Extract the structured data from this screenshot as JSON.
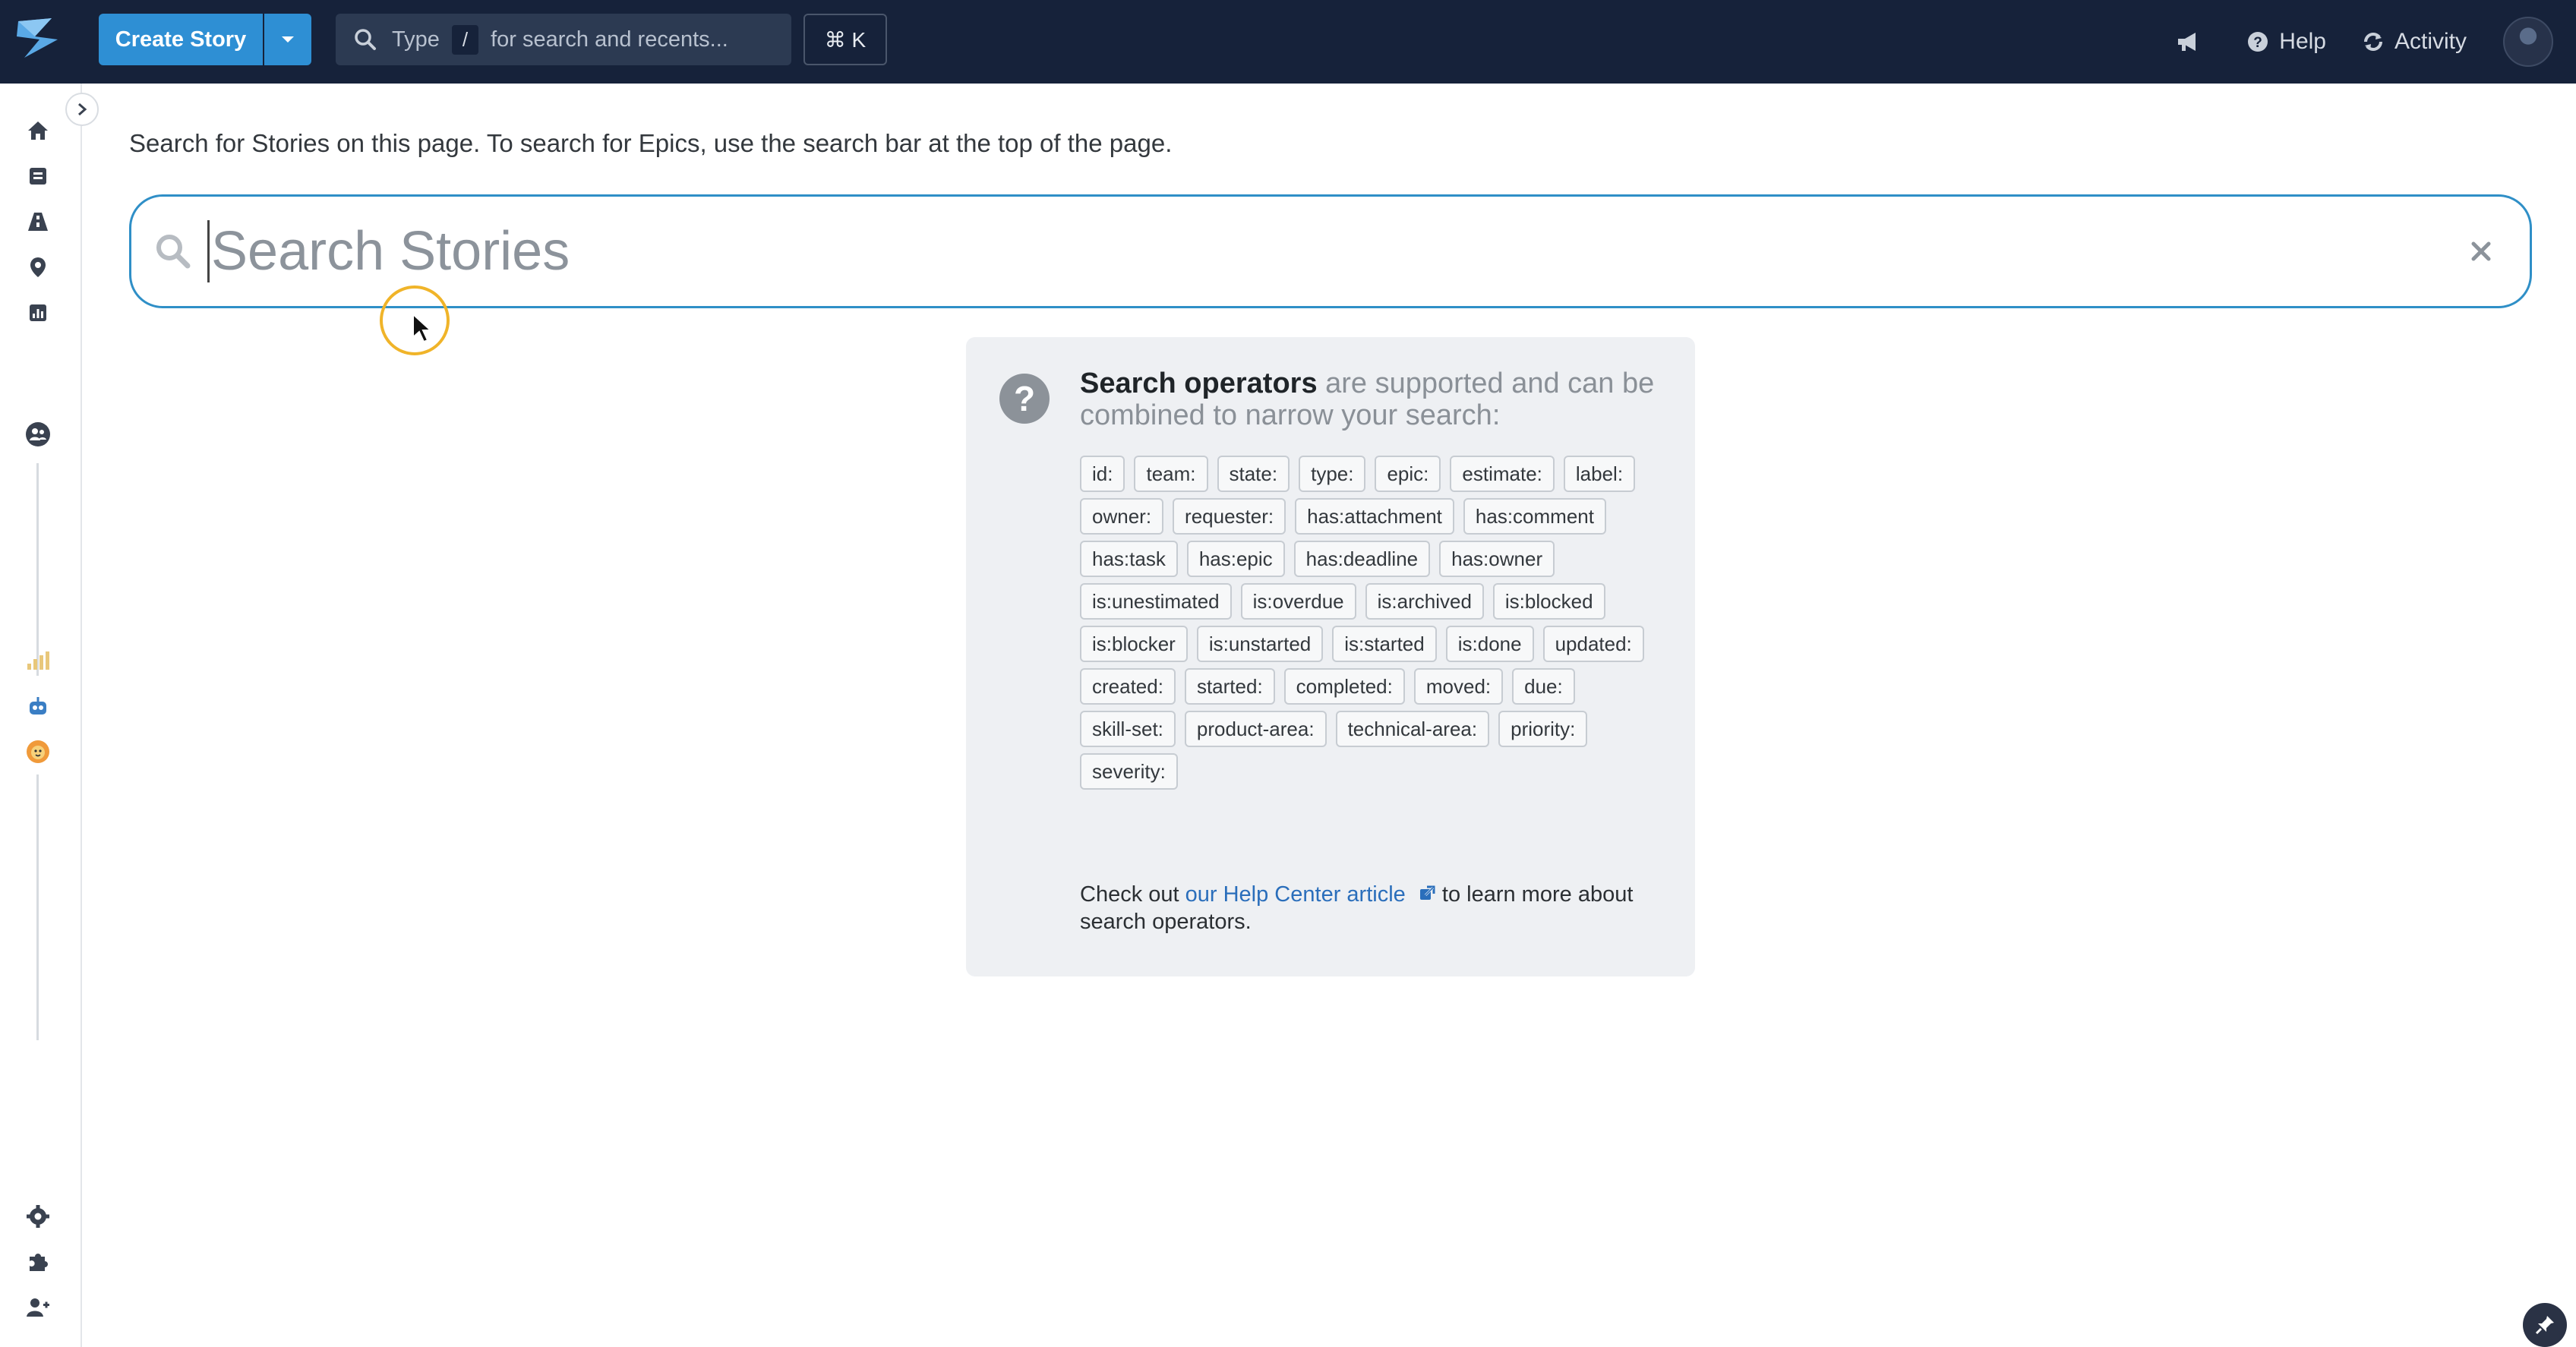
{
  "header": {
    "create_story_label": "Create Story",
    "search": {
      "type_label": "Type",
      "slash_key": "/",
      "hint": "for search and recents..."
    },
    "shortcut_label": "⌘ K",
    "help_label": "Help",
    "activity_label": "Activity"
  },
  "main": {
    "hint_text": "Search for Stories on this page. To search for Epics, use the search bar at the top of the page.",
    "search_placeholder": "Search Stories"
  },
  "operators": {
    "title_bold": "Search operators",
    "title_rest": " are supported and can be combined to narrow your search:",
    "tags": [
      "id:",
      "team:",
      "state:",
      "type:",
      "epic:",
      "estimate:",
      "label:",
      "owner:",
      "requester:",
      "has:attachment",
      "has:comment",
      "has:task",
      "has:epic",
      "has:deadline",
      "has:owner",
      "is:unestimated",
      "is:overdue",
      "is:archived",
      "is:blocked",
      "is:blocker",
      "is:unstarted",
      "is:started",
      "is:done",
      "updated:",
      "created:",
      "started:",
      "completed:",
      "moved:",
      "due:",
      "skill-set:",
      "product-area:",
      "technical-area:",
      "priority:",
      "severity:"
    ],
    "footer_pre": "Check out ",
    "footer_link": "our Help Center article",
    "footer_post": " to learn more about search operators."
  },
  "colors": {
    "topbar": "#16223a",
    "accent": "#2e8fd4",
    "search_border": "#2f8fc7",
    "cursor_ring": "#f0b429"
  }
}
